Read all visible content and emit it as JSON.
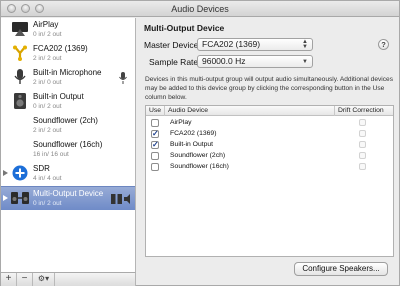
{
  "window": {
    "title": "Audio Devices"
  },
  "sidebar": {
    "devices": [
      {
        "name": "AirPlay",
        "channels": "0 in/ 2 out",
        "icon": "airplay-icon",
        "selected": false
      },
      {
        "name": "FCA202 (1369)",
        "channels": "2 in/ 2 out",
        "icon": "firewire-icon",
        "selected": false
      },
      {
        "name": "Built-in Microphone",
        "channels": "2 in/ 0 out",
        "icon": "microphone-icon",
        "selected": false
      },
      {
        "name": "Built-in Output",
        "channels": "0 in/ 2 out",
        "icon": "speaker-icon",
        "selected": false
      },
      {
        "name": "Soundflower (2ch)",
        "channels": "2 in/ 2 out",
        "icon": "none",
        "selected": false
      },
      {
        "name": "Soundflower (16ch)",
        "channels": "16 in/ 16 out",
        "icon": "none",
        "selected": false
      },
      {
        "name": "SDR",
        "channels": "4 in/ 4 out",
        "icon": "aggregate-plus-icon",
        "selected": false
      },
      {
        "name": "Multi-Output Device",
        "channels": "0 in/ 2 out",
        "icon": "multi-output-icon",
        "selected": true
      }
    ],
    "bottom_buttons": {
      "add": "+",
      "remove": "−",
      "gear": "⚙▾"
    }
  },
  "main": {
    "heading": "Multi-Output Device",
    "master_label": "Master Device:",
    "master_value": "FCA202 (1369)",
    "rate_label": "Sample Rate:",
    "rate_value": "96000.0 Hz",
    "help": "?",
    "description": "Devices in this multi-output group will output audio simultaneously. Additional devices may be added to this device group by clicking the corresponding button in the Use column below.",
    "table": {
      "headers": {
        "use": "Use",
        "device": "Audio Device",
        "drift": "Drift Correction"
      },
      "rows": [
        {
          "name": "AirPlay",
          "use": false
        },
        {
          "name": "FCA202 (1369)",
          "use": true
        },
        {
          "name": "Built-in Output",
          "use": true
        },
        {
          "name": "Soundflower (2ch)",
          "use": false
        },
        {
          "name": "Soundflower (16ch)",
          "use": false
        }
      ]
    },
    "configure_button": "Configure Speakers..."
  },
  "colors": {
    "selection": "#7f97cd",
    "check": "#1c3f8e"
  }
}
